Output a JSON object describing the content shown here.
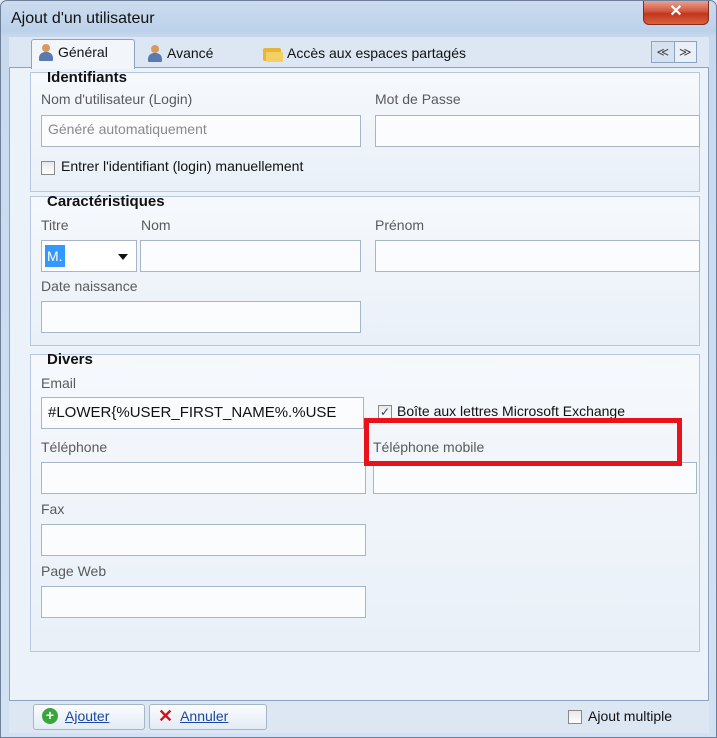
{
  "window": {
    "title": "Ajout d'un utilisateur",
    "close_glyph": "✕"
  },
  "tabs": [
    {
      "label": "Général",
      "icon": "user-icon",
      "active": true
    },
    {
      "label": "Avancé",
      "icon": "user-icon",
      "active": false
    },
    {
      "label": "Accès aux espaces partagés",
      "icon": "folder-icon",
      "active": false
    }
  ],
  "tab_nav": {
    "prev": "≪",
    "next": "≫"
  },
  "identifiants": {
    "title": "Identifiants",
    "login_label": "Nom d'utilisateur (Login)",
    "login_value": "Généré automatiquement",
    "password_label": "Mot de Passe",
    "password_value": "",
    "manual_login_label": "Entrer l'identifiant (login) manuellement",
    "manual_login_checked": false
  },
  "caracteristiques": {
    "title": "Caractéristiques",
    "titre_label": "Titre",
    "titre_value": "M.",
    "nom_label": "Nom",
    "nom_value": "",
    "prenom_label": "Prénom",
    "prenom_value": "",
    "date_label": "Date naissance",
    "date_value": ""
  },
  "divers": {
    "title": "Divers",
    "email_label": "Email",
    "email_value": "#LOWER{%USER_FIRST_NAME%.%USE",
    "exchange_label": "Boîte aux lettres Microsoft Exchange",
    "exchange_checked": true,
    "exchange_check_glyph": "✓",
    "telephone_label": "Téléphone",
    "telephone_value": "",
    "mobile_label": "Téléphone mobile",
    "mobile_value": "",
    "fax_label": "Fax",
    "fax_value": "",
    "web_label": "Page Web",
    "web_value": ""
  },
  "footer": {
    "add_label": "Ajouter",
    "cancel_label": "Annuler",
    "multiple_label": "Ajout multiple",
    "multiple_checked": false
  },
  "colors": {
    "highlight": "#e8121a",
    "selection": "#3399ff",
    "close_button": "#c2351c"
  }
}
